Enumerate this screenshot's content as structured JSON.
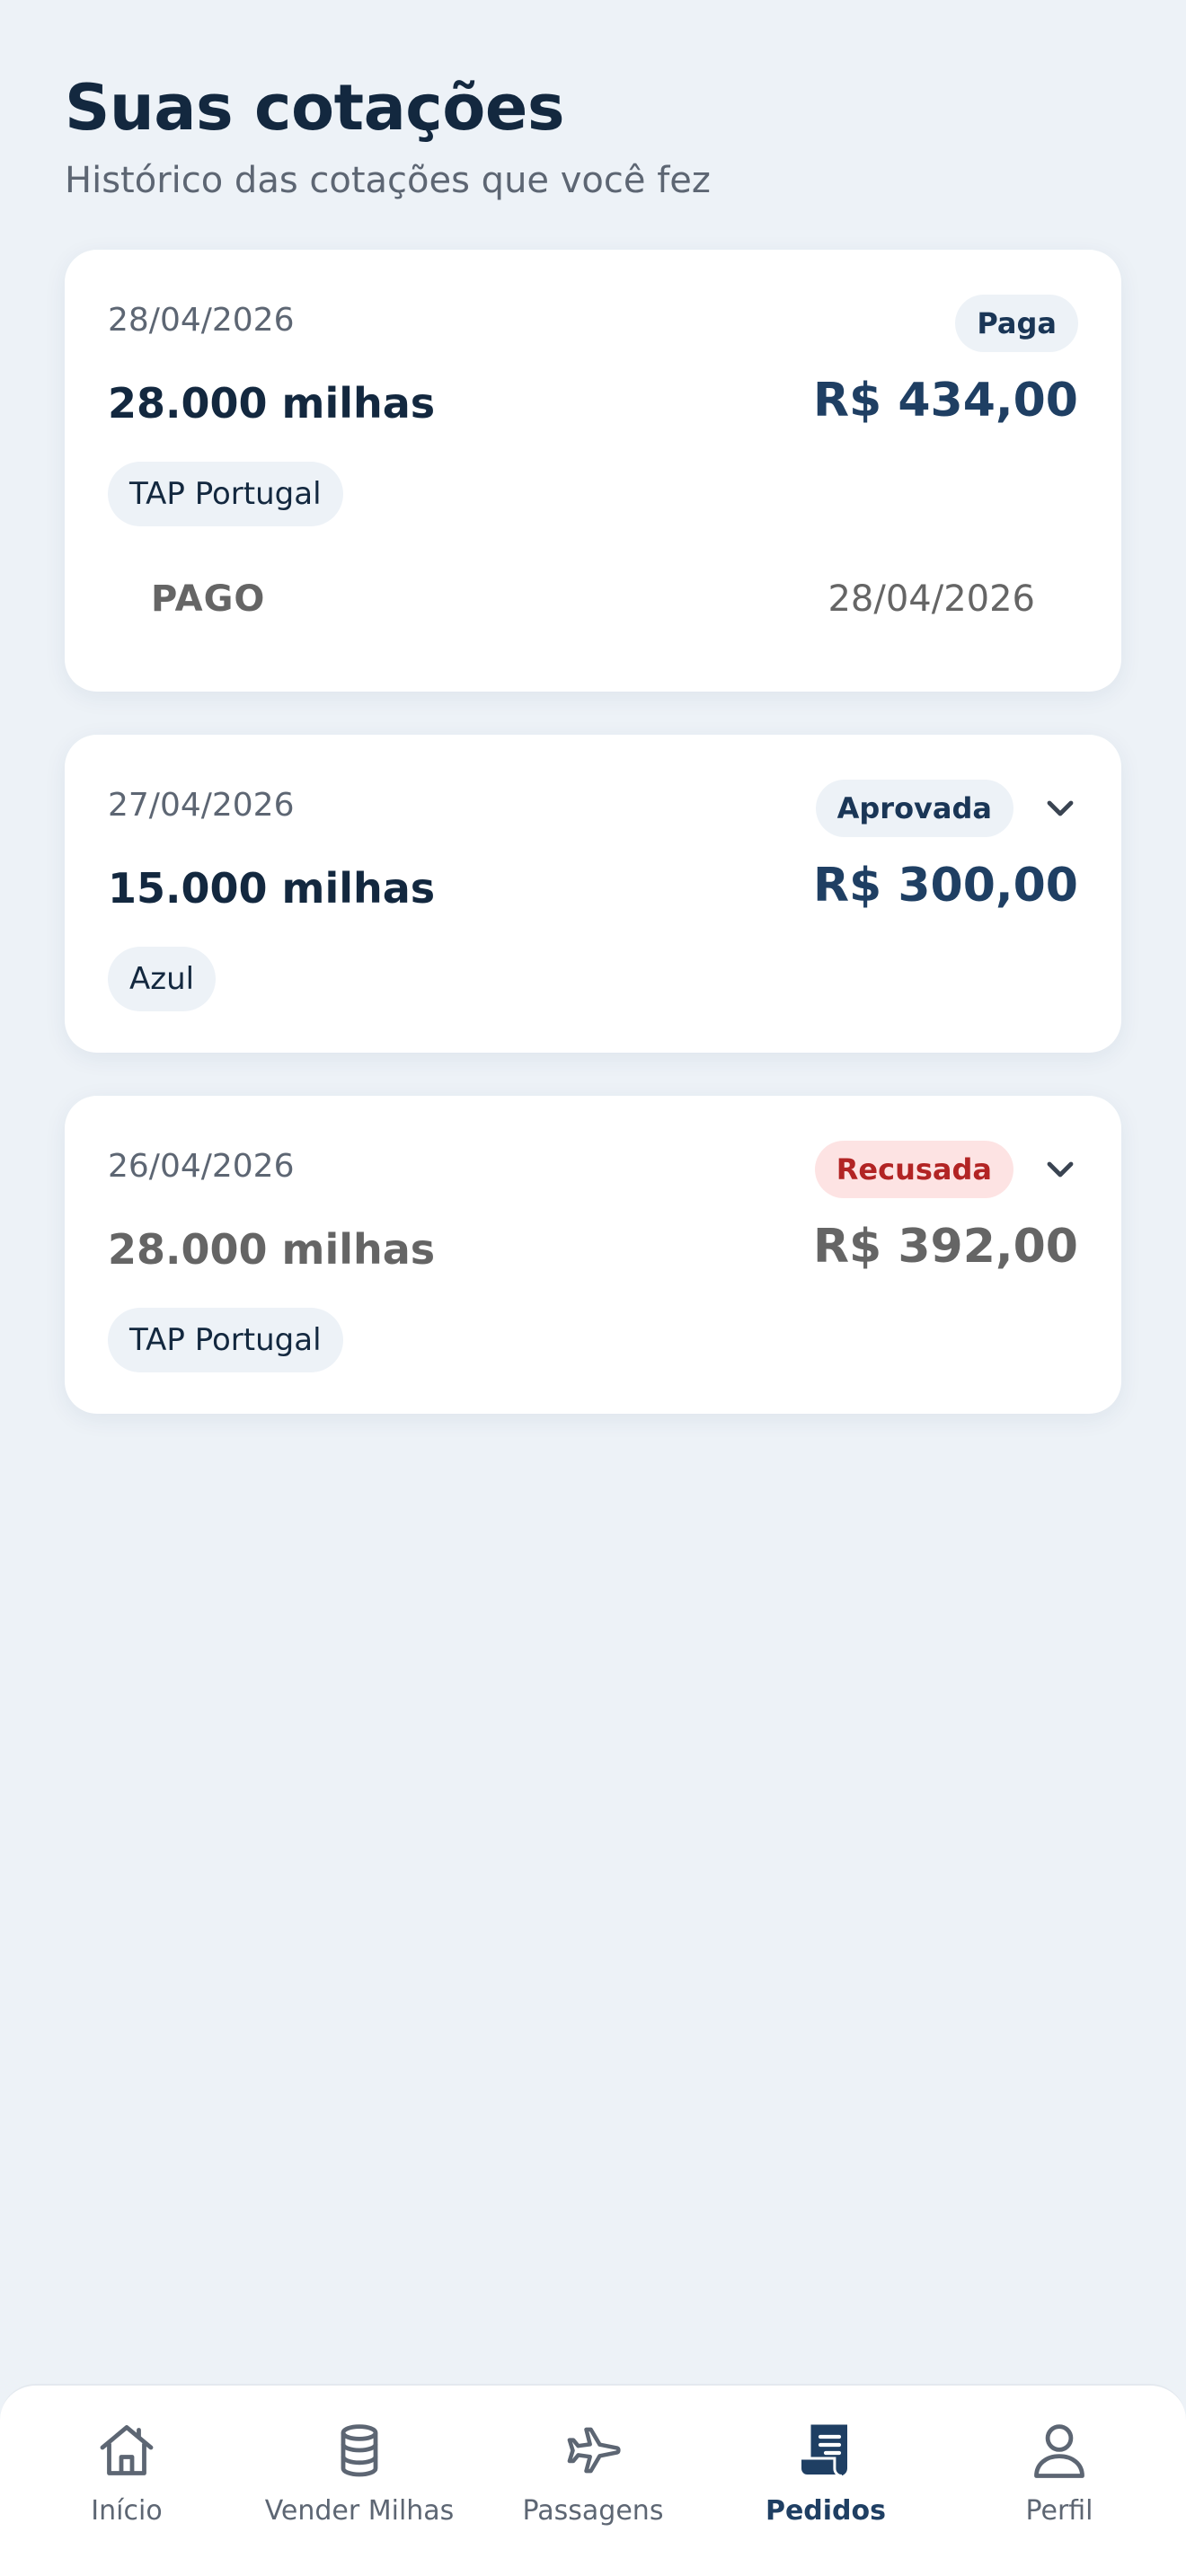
{
  "header": {
    "title": "Suas cotações",
    "subtitle": "Histórico das cotações que você fez"
  },
  "quotes": [
    {
      "date": "28/04/2026",
      "status": "Paga",
      "miles": "28.000 milhas",
      "price": "R$ 434,00",
      "airline": "TAP Portugal",
      "payment": {
        "status": "PAGO",
        "date": "28/04/2026"
      }
    },
    {
      "date": "27/04/2026",
      "status": "Aprovada",
      "miles": "15.000 milhas",
      "price": "R$ 300,00",
      "airline": "Azul"
    },
    {
      "date": "26/04/2026",
      "status": "Recusada",
      "miles": "28.000 milhas",
      "price": "R$ 392,00",
      "airline": "TAP Portugal"
    }
  ],
  "tabbar": {
    "items": [
      {
        "label": "Início",
        "icon": "home-icon"
      },
      {
        "label": "Vender Milhas",
        "icon": "coin-stack-icon"
      },
      {
        "label": "Passagens",
        "icon": "airplane-icon"
      },
      {
        "label": "Pedidos",
        "icon": "receipt-icon",
        "active": true
      },
      {
        "label": "Perfil",
        "icon": "user-icon"
      }
    ]
  },
  "colors": {
    "background": "#edf2f7",
    "primary": "#1f3f63",
    "title": "#13283f",
    "refused_bg": "#fde3e3",
    "refused_text": "#b22424",
    "muted": "#656565"
  }
}
